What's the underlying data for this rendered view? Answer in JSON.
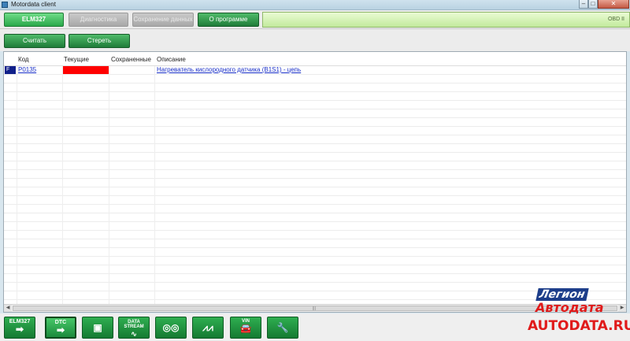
{
  "window": {
    "title": "Motordata client"
  },
  "tabs": [
    {
      "label": "ELM327",
      "state": "active"
    },
    {
      "label": "Диагностика",
      "state": "disabled"
    },
    {
      "label": "Сохранение данных",
      "state": "disabled"
    },
    {
      "label": "О программе",
      "state": "normal"
    }
  ],
  "status": {
    "right_text": "OBD II"
  },
  "actions": {
    "read_label": "Считать",
    "erase_label": "Стереть"
  },
  "table": {
    "headers": {
      "code": "Код",
      "current": "Текущие",
      "saved": "Сохраненные",
      "description": "Описание"
    },
    "rows": [
      {
        "flag": "F",
        "code": "P0135",
        "current_color": "#ff0000",
        "saved": "",
        "description": "Нагреватель кислородного датчика (B1S1) - цепь"
      }
    ]
  },
  "bottom": {
    "items": [
      {
        "label": "ELM327",
        "icon": "arrow-right-icon"
      },
      {
        "label": "DTC",
        "icon": "arrow-right-icon"
      },
      {
        "label": "",
        "icon": "camera-icon"
      },
      {
        "label": "DATA STREAM",
        "icon": "waveform-icon"
      },
      {
        "label": "",
        "icon": "circles-icon"
      },
      {
        "label": "",
        "icon": "zigzag-graph-icon"
      },
      {
        "label": "VIN",
        "icon": "car-icon"
      },
      {
        "label": "",
        "icon": "wrench-icon"
      }
    ]
  },
  "watermark": {
    "line1": "Легион",
    "line2": "Автодата",
    "line3": "AUTODATA.RU"
  },
  "colors": {
    "accent_green": "#2aa84a",
    "status_bg": "#c2ea9c",
    "error_red": "#ff0000",
    "flag_blue": "#10208a"
  }
}
